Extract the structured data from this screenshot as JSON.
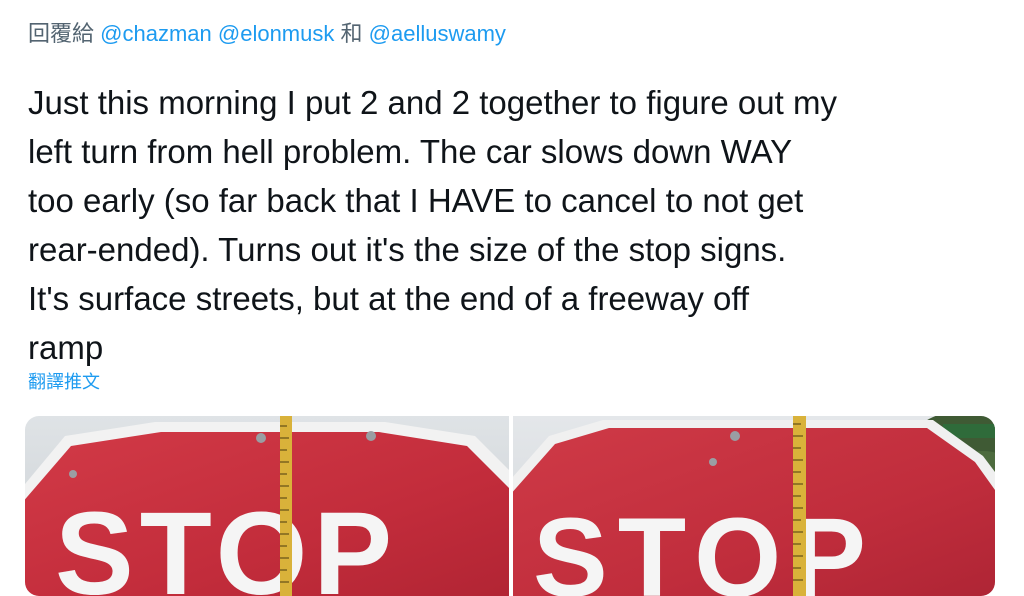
{
  "reply": {
    "prefix": "回覆給",
    "mentions": [
      "@chazman",
      "@elonmusk",
      "@aelluswamy"
    ],
    "joiner": "和"
  },
  "tweet": {
    "lines": [
      "Just this morning I put 2 and 2 together to figure out my",
      "left turn from hell problem. The car slows down WAY",
      "too early (so far back that I HAVE to cancel to not get",
      "rear-ended). Turns out it's the size of the stop signs.",
      "It's surface streets, but at the end of a freeway off",
      "ramp"
    ]
  },
  "translate_label": "翻譯推文",
  "media": {
    "photos": [
      {
        "sign_text": "STOP"
      },
      {
        "sign_text": "STOP"
      }
    ]
  },
  "colors": {
    "link": "#1d9bf0",
    "text": "#0f1419",
    "muted": "#536471",
    "sign_red": "#c8283a"
  }
}
